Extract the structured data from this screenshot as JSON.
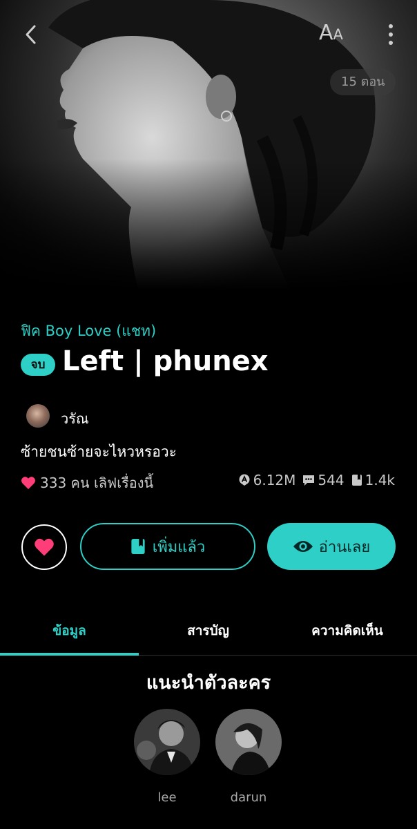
{
  "header": {
    "episode_count": "15 ตอน",
    "font_size_label": {
      "large": "A",
      "small": "A"
    },
    "icons": [
      "back-chevron-icon",
      "font-size-icon",
      "more-vertical-icon"
    ]
  },
  "story": {
    "genre": "ฟิค Boy Love (แชท)",
    "status": "จบ",
    "title": "Left | phunex",
    "author": "วรัณ",
    "tagline": "ซ้ายชนซ้ายจะไหวหรอวะ",
    "likes": "333 คน เลิฟเรื่องนี้",
    "views": "6.12M",
    "comments": "544",
    "adds": "1.4k"
  },
  "actions": {
    "library_label": "เพิ่มแล้ว",
    "read_label": "อ่านเลย"
  },
  "tabs": [
    {
      "label": "ข้อมูล",
      "active": true
    },
    {
      "label": "สารบัญ",
      "active": false
    },
    {
      "label": "ความคิดเห็น",
      "active": false
    }
  ],
  "characters": {
    "title": "แนะนำตัวละคร",
    "items": [
      {
        "name": "lee"
      },
      {
        "name": "darun"
      }
    ]
  },
  "colors": {
    "accent": "#2ecfc6",
    "heart": "#ff3d78",
    "background": "#000000"
  }
}
